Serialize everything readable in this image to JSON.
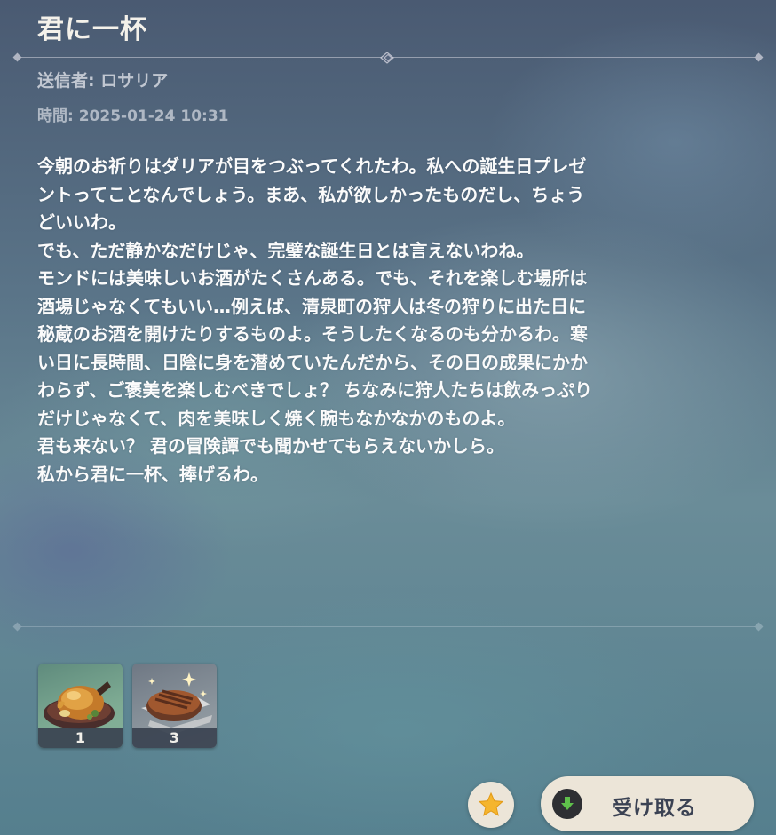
{
  "mail": {
    "title": "君に一杯",
    "sender": "送信者: ロサリア",
    "time": "時間: 2025-01-24 10:31",
    "body_lines": [
      "今朝のお祈りはダリアが目をつぶってくれたわ。私への誕生日プレゼ",
      "ントってことなんでしょう。まあ、私が欲しかったものだし、ちょう",
      "どいいわ。",
      "でも、ただ静かなだけじゃ、完璧な誕生日とは言えないわね。",
      "モンドには美味しいお酒がたくさんある。でも、それを楽しむ場所は",
      "酒場じゃなくてもいい…例えば、清泉町の狩人は冬の狩りに出た日に",
      "秘蔵のお酒を開けたりするものよ。そうしたくなるのも分かるわ。寒",
      "い日に長時間、日陰に身を潜めていたんだから、その日の成果にかか",
      "わらず、ご褒美を楽しむべきでしょ？ ちなみに狩人たちは飲みっぷり",
      "だけじゃなくて、肉を美味しく焼く腕もなかなかのものよ。",
      "君も来ない？ 君の冒険譚でも聞かせてもらえないかしら。",
      "私から君に一杯、捧げるわ。"
    ]
  },
  "attachments": [
    {
      "icon": "roast-chicken-dish-icon",
      "quantity": "1"
    },
    {
      "icon": "grilled-steak-icon",
      "quantity": "3"
    }
  ],
  "actions": {
    "favorite_icon": "star-icon",
    "claim_icon": "download-arrow-icon",
    "claim_label": "受け取る"
  },
  "colors": {
    "button_bg": "#ece5d8",
    "claim_text": "#3b4253",
    "star": "#f5b52e",
    "claim_arrow": "#5fc04b"
  }
}
